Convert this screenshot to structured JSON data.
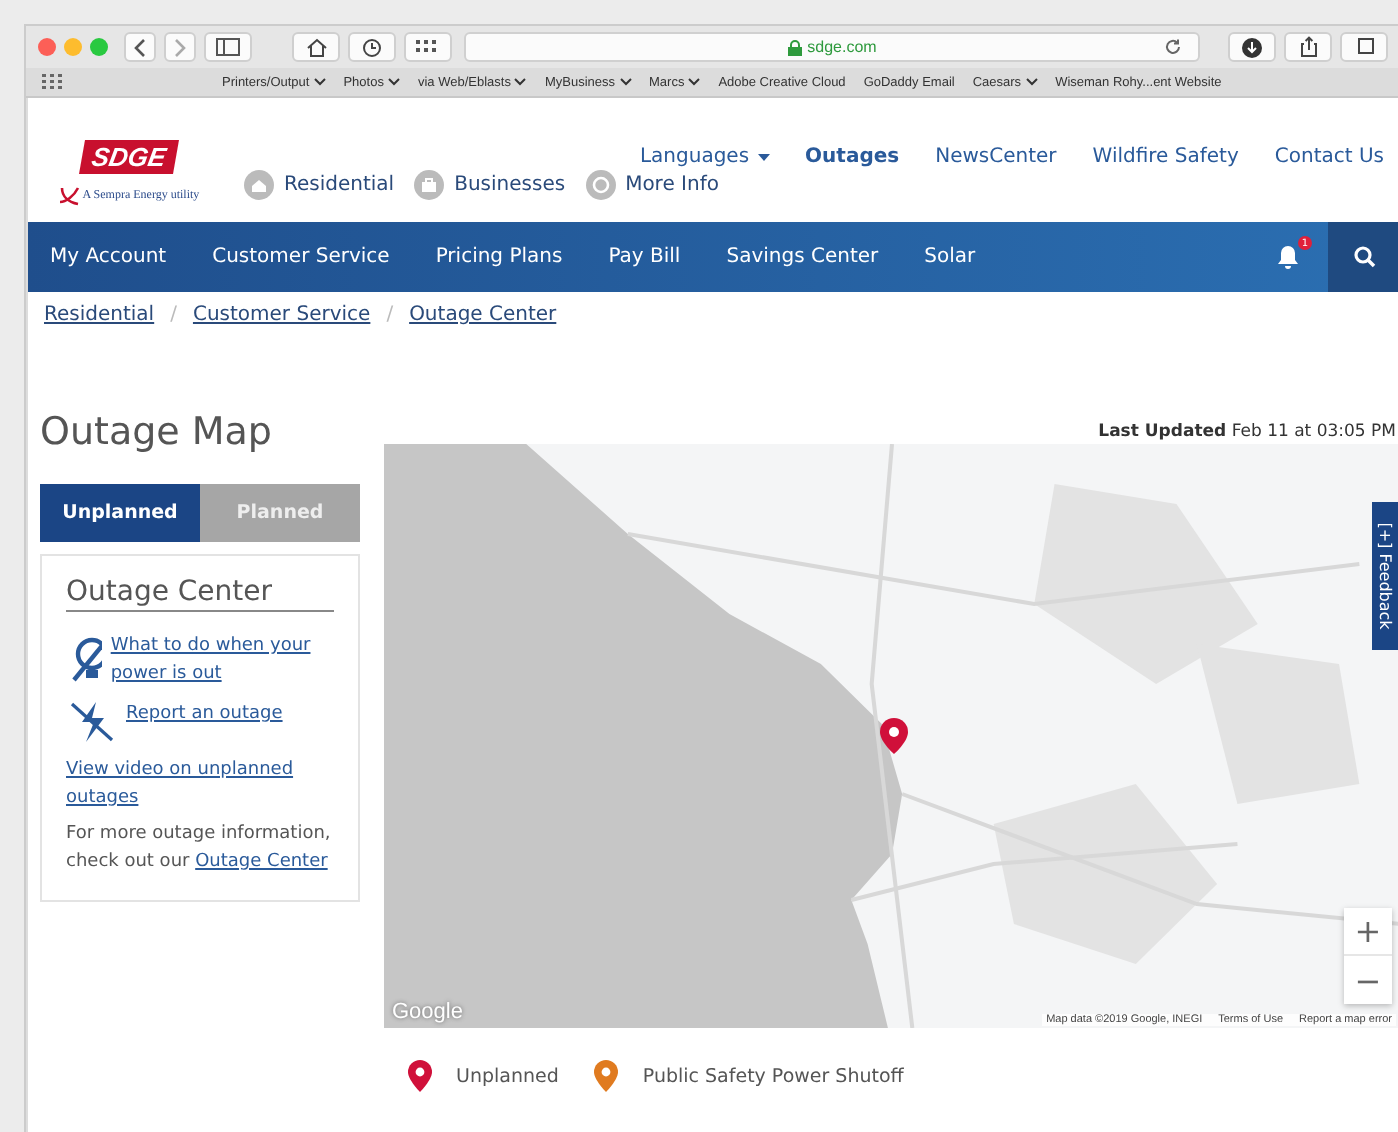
{
  "browser": {
    "address": "sdge.com",
    "bookmarks": [
      {
        "label": "Printers/Output",
        "dropdown": true
      },
      {
        "label": "Photos",
        "dropdown": true
      },
      {
        "label": "via Web/Eblasts",
        "dropdown": true
      },
      {
        "label": "MyBusiness",
        "dropdown": true
      },
      {
        "label": "Marcs",
        "dropdown": true
      },
      {
        "label": "Adobe Creative Cloud",
        "dropdown": false
      },
      {
        "label": "GoDaddy Email",
        "dropdown": false
      },
      {
        "label": "Caesars",
        "dropdown": true
      },
      {
        "label": "Wiseman Rohy...ent Website",
        "dropdown": false
      }
    ]
  },
  "header": {
    "logo": "SDGE",
    "tagline": "A Sempra Energy utility",
    "audience_links": [
      {
        "label": "Residential"
      },
      {
        "label": "Businesses"
      },
      {
        "label": "More Info"
      }
    ],
    "top_links": [
      {
        "label": "Languages",
        "dropdown": true,
        "selected": false
      },
      {
        "label": "Outages",
        "dropdown": false,
        "selected": true
      },
      {
        "label": "NewsCenter",
        "dropdown": false,
        "selected": false
      },
      {
        "label": "Wildfire Safety",
        "dropdown": false,
        "selected": false
      },
      {
        "label": "Contact Us",
        "dropdown": false,
        "selected": false
      }
    ]
  },
  "main_nav": {
    "items": [
      "My Account",
      "Customer Service",
      "Pricing Plans",
      "Pay Bill",
      "Savings Center",
      "Solar"
    ],
    "notification_count": "1"
  },
  "breadcrumbs": [
    "Residential",
    "Customer Service",
    "Outage Center"
  ],
  "breadcrumb_separator": "/",
  "page_title": "Outage Map",
  "last_updated": {
    "label": "Last Updated",
    "value": "Feb 11 at 03:05 PM"
  },
  "tabs": [
    {
      "label": "Unplanned",
      "selected": true
    },
    {
      "label": "Planned",
      "selected": false
    }
  ],
  "sidebar": {
    "title": "Outage Center",
    "items": [
      {
        "kind": "icon_link",
        "text": "What to do when your power is out"
      },
      {
        "kind": "icon_link",
        "text": "Report an outage"
      },
      {
        "kind": "link",
        "text": "View video on unplanned outages"
      },
      {
        "kind": "paragraph",
        "text": "For more outage information, check out our",
        "link": "Outage Center"
      }
    ]
  },
  "map": {
    "markers": [
      {
        "kind": "unplanned"
      }
    ],
    "logo": "Google",
    "attribution": "Map data ©2019 Google, INEGI",
    "terms": "Terms of Use",
    "report": "Report a map error",
    "zoom_in": "+",
    "zoom_out": "−",
    "feedback": "[+] Feedback"
  },
  "legend": [
    {
      "label": "Unplanned",
      "color": "#d0103a"
    },
    {
      "label": "Public Safety Power Shutoff",
      "color": "#e07b20"
    }
  ]
}
